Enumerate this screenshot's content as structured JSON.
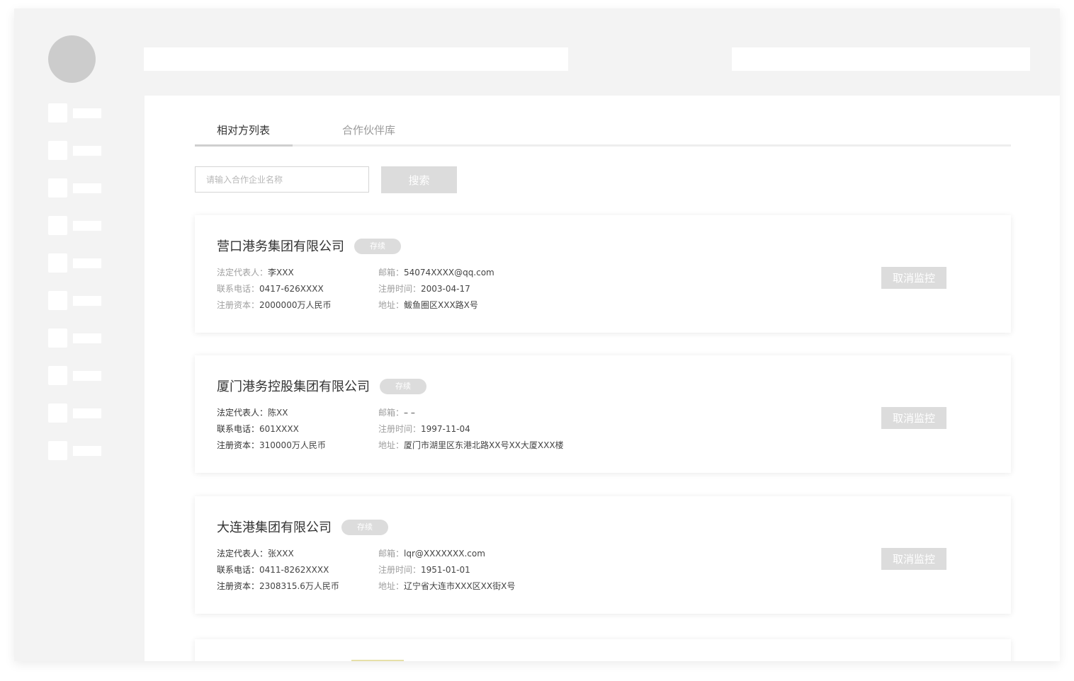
{
  "tabs": [
    {
      "label": "相对方列表",
      "active": true
    },
    {
      "label": "合作伙伴库",
      "active": false
    }
  ],
  "search": {
    "placeholder": "请输入合作企业名称",
    "button_label": "搜索"
  },
  "labels": {
    "legal_rep": "法定代表人：",
    "phone": "联系电话：",
    "capital": "注册资本：",
    "email": "邮箱：",
    "reg_date": "注册时间：",
    "address": "地址：",
    "cancel": "取消监控"
  },
  "companies": [
    {
      "name": "营口港务集团有限公司",
      "status": "存续",
      "legal_rep": "李XXX",
      "phone": "0417-626XXXX",
      "capital": "2000000万人民币",
      "email": "54074XXXX@qq.com",
      "reg_date": "2003-04-17",
      "address": "鲅鱼圈区XXX路X号"
    },
    {
      "name": "厦门港务控股集团有限公司",
      "status": "存续",
      "legal_rep": "陈XX",
      "phone": "601XXXX",
      "capital": "310000万人民币",
      "email": "– –",
      "reg_date": "1997-11-04",
      "address": "厦门市湖里区东港北路XX号XX大厦XXX楼"
    },
    {
      "name": "大连港集团有限公司",
      "status": "存续",
      "legal_rep": "张XXX",
      "phone": "0411-8262XXXX",
      "capital": "2308315.6万人民币",
      "email": "lqr@XXXXXXX.com",
      "reg_date": "1951-01-01",
      "address": "辽宁省大连市XXX区XX街X号"
    }
  ]
}
